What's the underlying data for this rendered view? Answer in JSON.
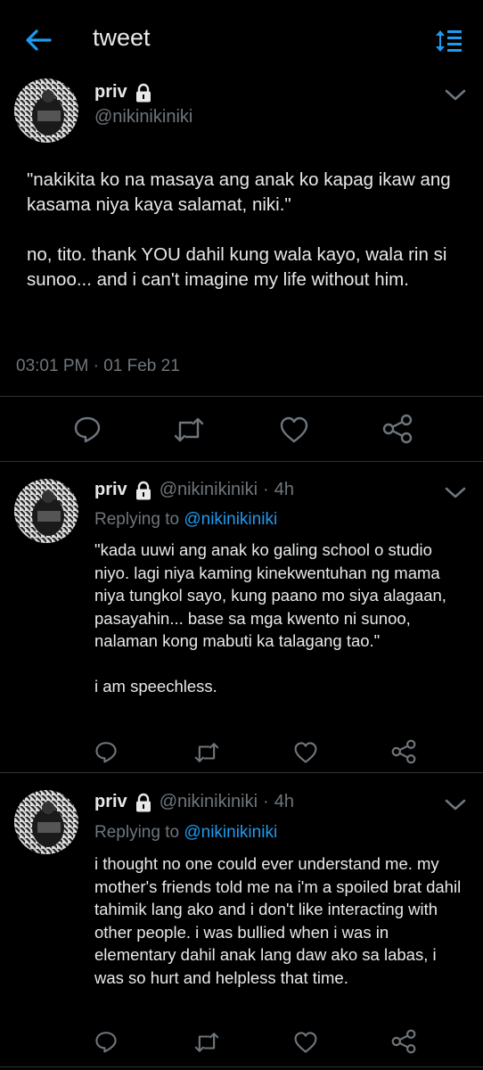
{
  "header": {
    "title": "tweet",
    "back_icon": "arrow-left-icon",
    "sort_icon": "sort-lines-icon",
    "accent_color": "#1d9bf0"
  },
  "main_tweet": {
    "display_name": "priv",
    "handle": "@nikinikiniki",
    "lock_icon": "lock-icon",
    "text": "\"nakikita ko na masaya ang anak ko kapag ikaw ang kasama niya kaya salamat, niki.\"\n\nno, tito. thank YOU dahil kung wala kayo, wala rin si sunoo... and i can't imagine my life without him.",
    "timestamp": "03:01 PM · 01 Feb 21",
    "actions": [
      "reply-icon",
      "retweet-icon",
      "like-icon",
      "share-icon"
    ]
  },
  "replies": [
    {
      "display_name": "priv",
      "handle": "@nikinikiniki",
      "separator": "·",
      "time": "4h",
      "replying_to_label": "Replying to",
      "replying_to_handle": "@nikinikiniki",
      "text": "\"kada uuwi ang anak ko galing school o studio niyo. lagi niya kaming kinekwentuhan ng mama niya tungkol sayo, kung paano mo siya alagaan, pasayahin... base sa mga kwento ni sunoo, nalaman kong mabuti ka talagang tao.\"\n\ni am speechless."
    },
    {
      "display_name": "priv",
      "handle": "@nikinikiniki",
      "separator": "·",
      "time": "4h",
      "replying_to_label": "Replying to",
      "replying_to_handle": "@nikinikiniki",
      "text": "i thought no one could ever understand me. my mother's friends told me na i'm a spoiled brat dahil tahimik lang ako and i don't like interacting with other people. i was bullied when i was in elementary dahil anak lang daw ako sa labas, i was so hurt and helpless that time."
    }
  ]
}
